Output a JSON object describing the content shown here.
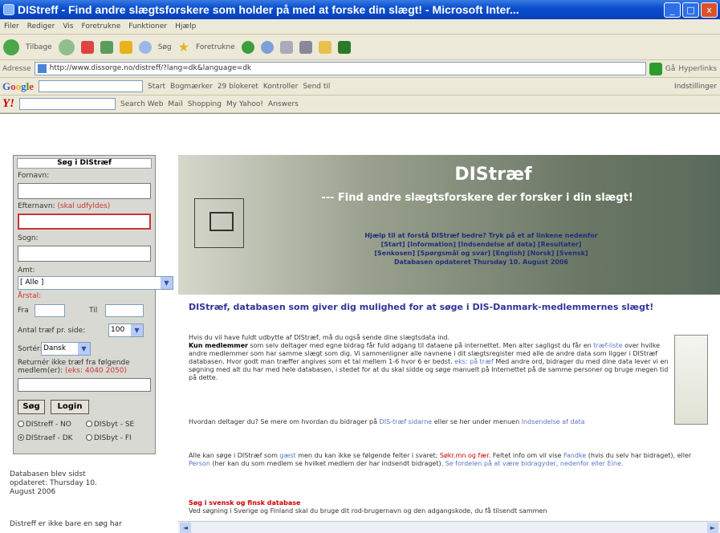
{
  "window": {
    "title": "DIStreff - Find andre slægtsforskere som holder på med at forske din slægt! - Microsoft Inter...",
    "buttons": [
      "_",
      "□",
      "x"
    ]
  },
  "menu": [
    "Filer",
    "Rediger",
    "Vis",
    "Foretrukne",
    "Funktioner",
    "Hjælp"
  ],
  "toolbar": {
    "back": "Tilbage",
    "search": "Søg",
    "favorites": "Foretrukne"
  },
  "address": {
    "label": "Adresse",
    "url": "http://www.dissorge.no/distreff/?lang=dk&language=dk",
    "go": "Gå",
    "links": "Hyperlinks"
  },
  "google_bar": {
    "logo": [
      "G",
      "o",
      "o",
      "g",
      "l",
      "e"
    ],
    "items": [
      "Start",
      "Bogmærker",
      "29 blokeret",
      "Kontroller",
      "Send til",
      "Indstillinger"
    ]
  },
  "yahoo_bar": {
    "logo": "Y!",
    "items": [
      "Search Web",
      "Mail",
      "Shopping",
      "My Yahoo!",
      "Answers"
    ]
  },
  "search_form": {
    "title": "Søg i DIStræf",
    "fornavn_label": "Fornavn:",
    "efternavn_label": "Efternavn:",
    "efternavn_required": "(skal udfyldes)",
    "sogn_label": "Sogn:",
    "amt_label": "Amt:",
    "amt_value": "[ Alle ]",
    "aarstal_label": "Årstal:",
    "fra_label": "Fra",
    "til_label": "Til",
    "results_label": "Antal træf pr. side:",
    "results_value": "100",
    "sort_label": "Sortér:",
    "sort_value": "Dansk",
    "exclude_label": "Returnér ikke træf fra følgende medlem(er):",
    "exclude_hint": "(eks: 4040 2050)",
    "search_button": "Søg",
    "login_button": "Login",
    "radios": [
      "DIStreff - NO",
      "DISbyt - SE",
      "DIStraef - DK",
      "DISbyt - FI"
    ],
    "selected_radio": "DIStraef - DK"
  },
  "left_notes": {
    "updated": "Databasen blev sidst opdateret: Thursday 10. August 2006",
    "note": "Distreff er ikke bare en søg har"
  },
  "banner": {
    "title": "DIStræf",
    "subtitle": "--- Find andre slægtsforskere der forsker i din slægt!",
    "help": "Hjælp til at forstå DIStræf bedre? Tryk på et af linkene nedenfor",
    "links1": "[Start] [Information] [Indsendelse af data] [Resultater]",
    "links2": "[Senkosen] [Spørgsmål og svar] [English] [Norsk] [Svensk]",
    "updated": "Databasen opdateret Thursday 10. August 2006"
  },
  "content": {
    "heading": "DIStræf, databasen som giver dig mulighed for at søge i DIS-Danmark-medlemmernes slægt!",
    "p1_lead": "Hvis du vil have fuldt udbytte af DIStræf, må du også sende dine slægtsdata ind.",
    "p1_bold": "Kun medlemmer",
    "p1_text": "som selv deltager med egne bidrag får fuld adgang til dataene på internettet. Men alter sagligst du får en",
    "p1_link": "træf-liste",
    "p1_rest": "over hvilke andre medlemmer som har samme slægt som dig. Vi sammenligner alle navnene i dit slægtsregister med alle de andre data som ligger i DIStræf databasen. Hvor godt man træffer angives som et tal mellem 1-6 hvor 6 er bedst.",
    "p1_link2": "eks: på træf",
    "p1_end": "Med andre ord, bidrager du med dine data lever vi en søgning med alt du har med hele databasen, i stedet for at du skal sidde og søge manuelt på Internettet på de samme personer og bruge megen tid på dette.",
    "p2_text": "Hvordan deltager du? Se mere om hvordan du bidrager på",
    "p2_link": "DIS-træf sidarne",
    "p2_mid": "eller se her under menuen",
    "p2_link2": "Indsendelse af data",
    "p3_text": "Alle kan søge i DIStræf som",
    "p3_link": "gæst",
    "p3_mid": "men du kan ikke se følgende felter i svaret;",
    "p3_red": "Søkr.mn og fær",
    "p3_rest": ". Feltet info om vil vise",
    "p3_link2": "Fandke",
    "p3_rest2": "(hvis du selv har bidraget), eller",
    "p3_link3": "Person",
    "p3_rest3": "(her kan du som medlem se hvilket medlem der har indsendt bidraget).",
    "p3_link4": "Se fordelen på at være bidragyder, nedenfor eller Eine.",
    "p4_red": "Søg i svensk og finsk database",
    "p4_text": "Ved søgning i Sverige og Finland skal du bruge dit rod-brugernavn og den adgangskode, du få tilsendt sammen"
  }
}
